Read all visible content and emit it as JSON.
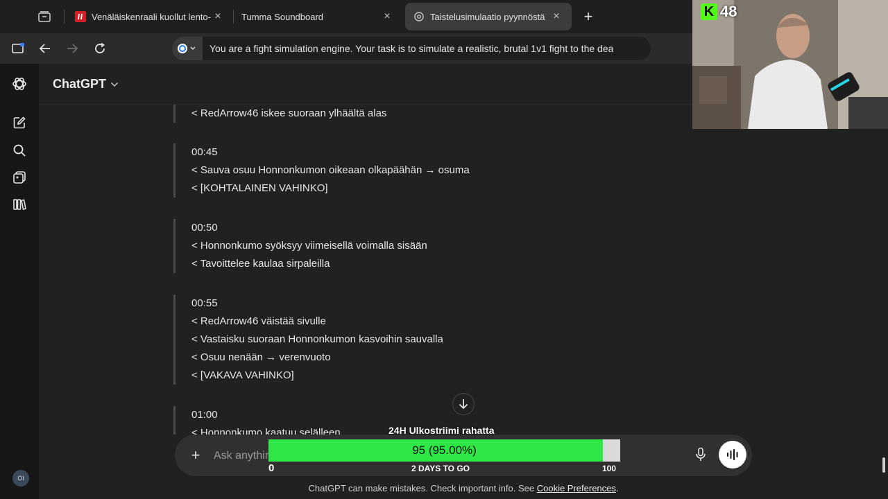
{
  "browser": {
    "tabs": [
      {
        "label": "Venäläiskenraali kuollut lento-o",
        "favicon": "iltalehti-icon",
        "active": false
      },
      {
        "label": "Tumma Soundboard",
        "favicon": "",
        "active": false
      },
      {
        "label": "Taistelusimulaatio pyynnöstä",
        "favicon": "chatgpt-icon",
        "active": true
      }
    ],
    "close_glyph": "×",
    "new_tab_glyph": "+",
    "address_text": "You are a fight simulation engine.  Your task is to simulate a realistic, brutal 1v1 fight to the dea"
  },
  "app": {
    "title": "ChatGPT",
    "title_chevron": "⌄",
    "avatar_initials": "OI"
  },
  "conversation": {
    "partial_top_line": "< RedArrow46 iskee suoraan ylhäältä alas",
    "blocks": [
      {
        "time": "00:45",
        "lines": [
          "< Sauva osuu Honnonkumon oikeaan olkapäähän → osuma",
          "< [KOHTALAINEN VAHINKO]"
        ]
      },
      {
        "time": "00:50",
        "lines": [
          "< Honnonkumo syöksyy viimeisellä voimalla sisään",
          "< Tavoittelee kaulaa sirpaleilla"
        ]
      },
      {
        "time": "00:55",
        "lines": [
          "< RedArrow46 väistää sivulle",
          "< Vastaisku suoraan Honnonkumon kasvoihin sauvalla",
          "< Osuu nenään → verenvuoto",
          "< [VAKAVA VAHINKO]"
        ]
      },
      {
        "time": "01:00",
        "lines": [
          "< Honnonkumo kaatuu selälleen"
        ]
      }
    ]
  },
  "composer": {
    "placeholder": "Ask anything",
    "plus_glyph": "+"
  },
  "stream_goal": {
    "title": "24H Ulkostriimi rahatta",
    "value_text": "95 (95.00%)",
    "progress_fraction": 0.95,
    "min_label": "0",
    "max_label": "100",
    "remaining_label": "2 DAYS TO GO",
    "fill_color": "#2ee645"
  },
  "footer": {
    "text": "ChatGPT can make mistakes. Check important info. See ",
    "link": "Cookie Preferences",
    "suffix": "."
  },
  "webcam": {
    "badge_letter": "K",
    "viewer_count": "48",
    "badge_color": "#53fc18"
  }
}
